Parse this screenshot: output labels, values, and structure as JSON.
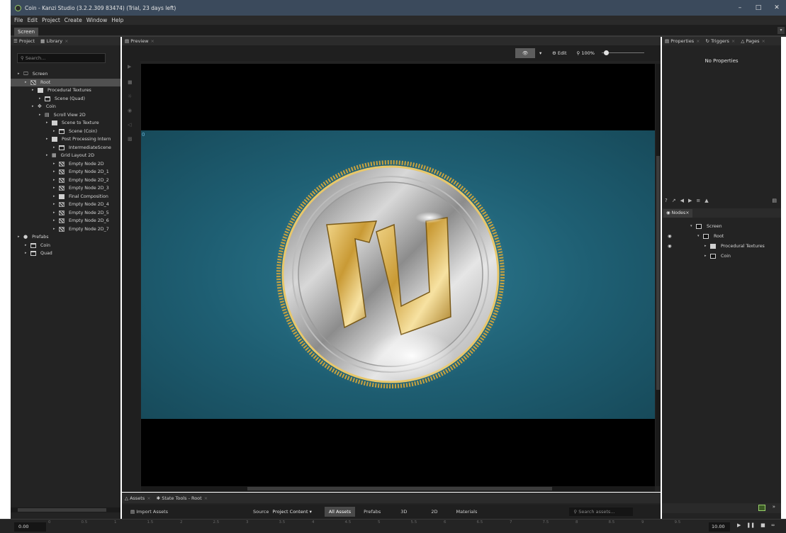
{
  "window": {
    "title": "Coin - Kanzi Studio (3.2.2.309 83474) (Trial, 23 days left)"
  },
  "menu": [
    "File",
    "Edit",
    "Project",
    "Create",
    "Window",
    "Help"
  ],
  "document_tab": "Screen",
  "left_panel": {
    "tabs": [
      "Project",
      "Library"
    ],
    "search_placeholder": "Search...",
    "tree": [
      {
        "label": "Screen",
        "depth": 0,
        "icon": "monitor-icon"
      },
      {
        "label": "Root",
        "depth": 1,
        "icon": "node2d-icon",
        "selected": true
      },
      {
        "label": "Procedural Textures",
        "depth": 2,
        "icon": "render-pass-icon"
      },
      {
        "label": "Scene (Quad)",
        "depth": 3,
        "icon": "scene-icon"
      },
      {
        "label": "Coin",
        "depth": 2,
        "icon": "transform-icon"
      },
      {
        "label": "Scroll View 2D",
        "depth": 3,
        "icon": "scrollview-icon"
      },
      {
        "label": "Scene to Texture",
        "depth": 4,
        "icon": "render-pass-icon"
      },
      {
        "label": "Scene (Coin)",
        "depth": 5,
        "icon": "scene-icon"
      },
      {
        "label": "Post Processing Intern",
        "depth": 4,
        "icon": "render-pass-icon"
      },
      {
        "label": "IntermediateScene",
        "depth": 5,
        "icon": "scene-icon"
      },
      {
        "label": "Grid Layout 2D",
        "depth": 4,
        "icon": "grid-icon"
      },
      {
        "label": "Empty Node 2D",
        "depth": 5,
        "icon": "node2d-icon"
      },
      {
        "label": "Empty Node 2D_1",
        "depth": 5,
        "icon": "node2d-icon"
      },
      {
        "label": "Empty Node 2D_2",
        "depth": 5,
        "icon": "node2d-icon"
      },
      {
        "label": "Empty Node 2D_3",
        "depth": 5,
        "icon": "node2d-icon"
      },
      {
        "label": "Final Composition",
        "depth": 5,
        "icon": "render-pass-icon"
      },
      {
        "label": "Empty Node 2D_4",
        "depth": 5,
        "icon": "node2d-icon"
      },
      {
        "label": "Empty Node 2D_5",
        "depth": 5,
        "icon": "node2d-icon"
      },
      {
        "label": "Empty Node 2D_6",
        "depth": 5,
        "icon": "node2d-icon"
      },
      {
        "label": "Empty Node 2D_7",
        "depth": 5,
        "icon": "node2d-icon"
      },
      {
        "label": "Prefabs",
        "depth": 0,
        "icon": "prefab-icon"
      },
      {
        "label": "Coin",
        "depth": 1,
        "icon": "scene-icon"
      },
      {
        "label": "Quad",
        "depth": 1,
        "icon": "scene-icon"
      }
    ]
  },
  "preview": {
    "tab": "Preview",
    "edit_label": "Edit",
    "zoom": "100%",
    "overlay_label": "0"
  },
  "right_panel": {
    "tabs": [
      "Properties",
      "Triggers",
      "Pages"
    ],
    "no_properties": "No Properties",
    "nodes_tab": "Nodes",
    "nodes": [
      {
        "label": "Screen",
        "depth": 0,
        "eye": false
      },
      {
        "label": "Root",
        "depth": 1,
        "eye": true
      },
      {
        "label": "Procedural Textures",
        "depth": 2,
        "eye": true
      },
      {
        "label": "Coin",
        "depth": 2,
        "eye": false
      }
    ]
  },
  "bottom_panel": {
    "tabs": [
      "Assets",
      "State Tools - Root"
    ],
    "import_label": "Import Assets",
    "source_label": "Source",
    "source_value": "Project Content",
    "filters": [
      "All Assets",
      "Prefabs",
      "3D",
      "2D",
      "Materials"
    ],
    "search_placeholder": "Search assets..."
  },
  "timeline": {
    "start": "0.00",
    "end": "10.00",
    "ticks": [
      "0",
      "0.5",
      "1",
      "1.5",
      "2",
      "2.5",
      "3",
      "3.5",
      "4",
      "4.5",
      "5",
      "5.5",
      "6",
      "6.5",
      "7",
      "7.5",
      "8",
      "8.5",
      "9",
      "9.5"
    ]
  },
  "colors": {
    "titlebar": "#3b4a5c",
    "viewport_bg": "#1e5e72",
    "coin_gold": "#d4a93a",
    "coin_silver": "#c8c8c8"
  }
}
